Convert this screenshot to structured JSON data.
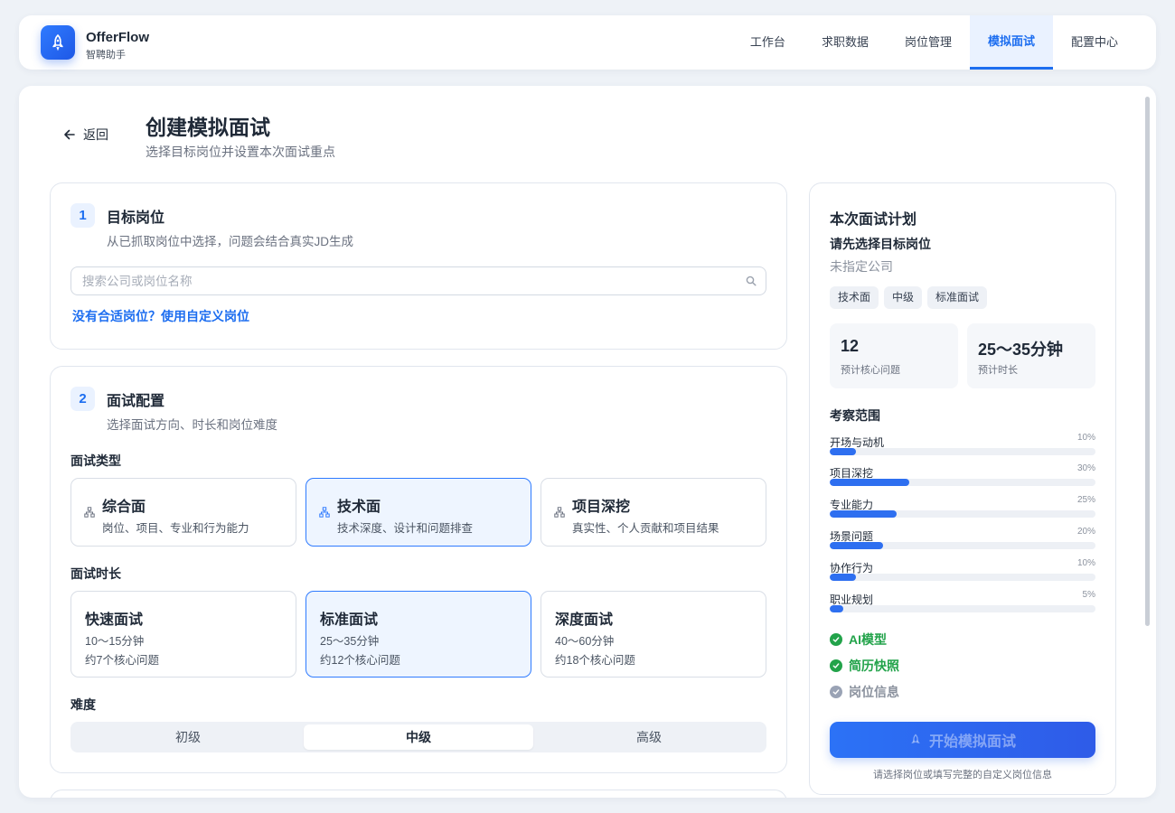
{
  "brand": {
    "name": "OfferFlow",
    "subtitle": "智聘助手"
  },
  "nav": [
    {
      "label": "工作台"
    },
    {
      "label": "求职数据"
    },
    {
      "label": "岗位管理"
    },
    {
      "label": "模拟面试",
      "active": true
    },
    {
      "label": "配置中心"
    }
  ],
  "header": {
    "back_label": "返回",
    "title": "创建模拟面试",
    "subtitle": "选择目标岗位并设置本次面试重点"
  },
  "section1": {
    "step": "1",
    "title": "目标岗位",
    "subtitle": "从已抓取岗位中选择，问题会结合真实JD生成",
    "search_placeholder": "搜索公司或岗位名称",
    "search_value": "",
    "custom_link": "没有合适岗位？使用自定义岗位"
  },
  "section2": {
    "step": "2",
    "title": "面试配置",
    "subtitle": "选择面试方向、时长和岗位难度",
    "type_label": "面试类型",
    "types": [
      {
        "title": "综合面",
        "desc": "岗位、项目、专业和行为能力",
        "icon": "org-chart-icon"
      },
      {
        "title": "技术面",
        "desc": "技术深度、设计和问题排查",
        "icon": "org-chart-icon",
        "selected": true
      },
      {
        "title": "项目深挖",
        "desc": "真实性、个人贡献和项目结果",
        "icon": "org-chart-icon"
      }
    ],
    "duration_label": "面试时长",
    "durations": [
      {
        "title": "快速面试",
        "time": "10～15分钟",
        "count": "约7个核心问题"
      },
      {
        "title": "标准面试",
        "time": "25～35分钟",
        "count": "约12个核心问题",
        "selected": true
      },
      {
        "title": "深度面试",
        "time": "40～60分钟",
        "count": "约18个核心问题"
      }
    ],
    "difficulty_label": "难度",
    "difficulties": [
      "初级",
      "中级",
      "高级"
    ],
    "difficulty_selected": "中级"
  },
  "plan": {
    "title": "本次面试计划",
    "job": "请先选择目标岗位",
    "company": "未指定公司",
    "tags": [
      "技术面",
      "中级",
      "标准面试"
    ],
    "stats": [
      {
        "value": "12",
        "label": "预计核心问题"
      },
      {
        "value": "25～35分钟",
        "label": "预计时长"
      }
    ],
    "scope_title": "考察范围",
    "scope": [
      {
        "label": "开场与动机",
        "pct": "10%",
        "value": 10
      },
      {
        "label": "项目深挖",
        "pct": "30%",
        "value": 30
      },
      {
        "label": "专业能力",
        "pct": "25%",
        "value": 25
      },
      {
        "label": "场景问题",
        "pct": "20%",
        "value": 20
      },
      {
        "label": "协作行为",
        "pct": "10%",
        "value": 10
      },
      {
        "label": "职业规划",
        "pct": "5%",
        "value": 5
      }
    ],
    "checks": [
      {
        "label": "AI模型",
        "ok": true
      },
      {
        "label": "简历快照",
        "ok": true
      },
      {
        "label": "岗位信息",
        "ok": false
      }
    ],
    "start_label": "开始模拟面试",
    "hint": "请选择岗位或填写完整的自定义岗位信息"
  },
  "colors": {
    "accent": "#1d6ef0",
    "success": "#22a34a",
    "muted": "#8b929e"
  }
}
